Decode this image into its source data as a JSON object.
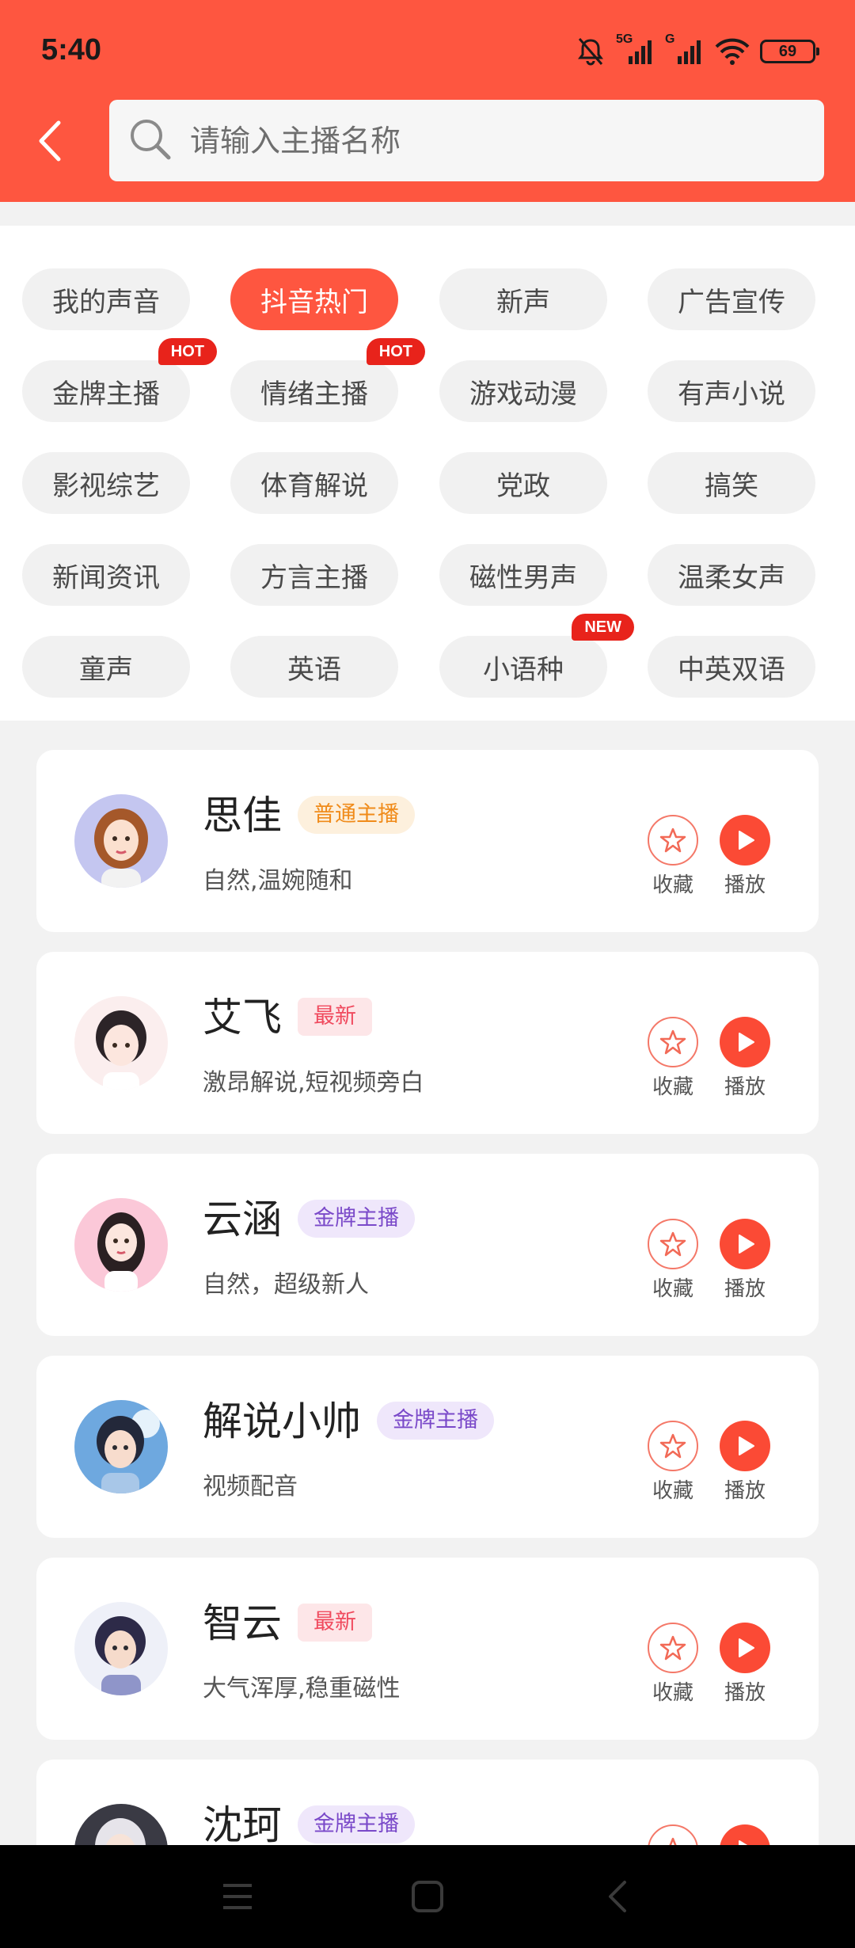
{
  "status": {
    "time": "5:40",
    "battery": "69",
    "network_1": "5G",
    "network_2": "G"
  },
  "search": {
    "placeholder": "请输入主播名称"
  },
  "categories": [
    {
      "label": "我的声音",
      "active": false,
      "badge": ""
    },
    {
      "label": "抖音热门",
      "active": true,
      "badge": ""
    },
    {
      "label": "新声",
      "active": false,
      "badge": ""
    },
    {
      "label": "广告宣传",
      "active": false,
      "badge": ""
    },
    {
      "label": "金牌主播",
      "active": false,
      "badge": "HOT"
    },
    {
      "label": "情绪主播",
      "active": false,
      "badge": "HOT"
    },
    {
      "label": "游戏动漫",
      "active": false,
      "badge": ""
    },
    {
      "label": "有声小说",
      "active": false,
      "badge": ""
    },
    {
      "label": "影视综艺",
      "active": false,
      "badge": ""
    },
    {
      "label": "体育解说",
      "active": false,
      "badge": ""
    },
    {
      "label": "党政",
      "active": false,
      "badge": ""
    },
    {
      "label": "搞笑",
      "active": false,
      "badge": ""
    },
    {
      "label": "新闻资讯",
      "active": false,
      "badge": ""
    },
    {
      "label": "方言主播",
      "active": false,
      "badge": ""
    },
    {
      "label": "磁性男声",
      "active": false,
      "badge": ""
    },
    {
      "label": "温柔女声",
      "active": false,
      "badge": ""
    },
    {
      "label": "童声",
      "active": false,
      "badge": ""
    },
    {
      "label": "英语",
      "active": false,
      "badge": ""
    },
    {
      "label": "小语种",
      "active": false,
      "badge": "NEW"
    },
    {
      "label": "中英双语",
      "active": false,
      "badge": ""
    }
  ],
  "anchors": [
    {
      "name": "思佳",
      "tag": "普通主播",
      "tag_type": "normal",
      "desc": "自然,温婉随和"
    },
    {
      "name": "艾飞",
      "tag": "最新",
      "tag_type": "newtag",
      "desc": "激昂解说,短视频旁白"
    },
    {
      "name": "云涵",
      "tag": "金牌主播",
      "tag_type": "gold",
      "desc": "自然，超级新人"
    },
    {
      "name": "解说小帅",
      "tag": "金牌主播",
      "tag_type": "gold",
      "desc": "视频配音"
    },
    {
      "name": "智云",
      "tag": "最新",
      "tag_type": "newtag",
      "desc": "大气浑厚,稳重磁性"
    },
    {
      "name": "沈珂",
      "tag": "金牌主播",
      "tag_type": "gold",
      "desc": ""
    }
  ],
  "actions": {
    "favorite_label": "收藏",
    "play_label": "播放"
  },
  "colors": {
    "accent": "#fe5640",
    "hot_badge": "#e8231b"
  },
  "icons": {
    "back": "chevron-left-icon",
    "search": "search-icon",
    "favorite": "star-icon",
    "play": "play-icon"
  }
}
